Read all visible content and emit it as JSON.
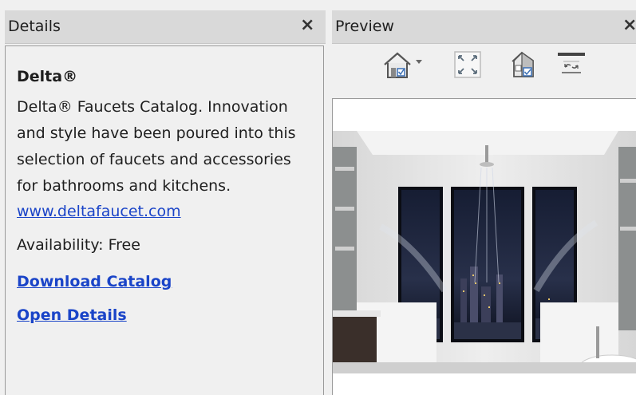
{
  "details": {
    "title": "Details",
    "close_label": "×",
    "product_name": "Delta®",
    "description": "Delta® Faucets Catalog. Innovation and style have been poured into this selection of faucets and accessories for bathrooms and kitchens.",
    "website": "www.deltafaucet.com",
    "availability": "Availability:  Free",
    "download_label": "Download Catalog",
    "open_details_label": "Open Details"
  },
  "preview": {
    "title": "Preview",
    "close_label": "×",
    "toolbar": [
      {
        "name": "home-view-icon",
        "label": "Home view with dropdown"
      },
      {
        "name": "fit-view-icon",
        "label": "Fit to window"
      },
      {
        "name": "3d-view-icon",
        "label": "3D view"
      },
      {
        "name": "rotate-icon",
        "label": "Rotate"
      }
    ]
  },
  "colors": {
    "link": "#1a44c8",
    "header_bg": "#d9d9d9",
    "panel_bg": "#f0f0f0",
    "border": "#9a9a9a"
  }
}
